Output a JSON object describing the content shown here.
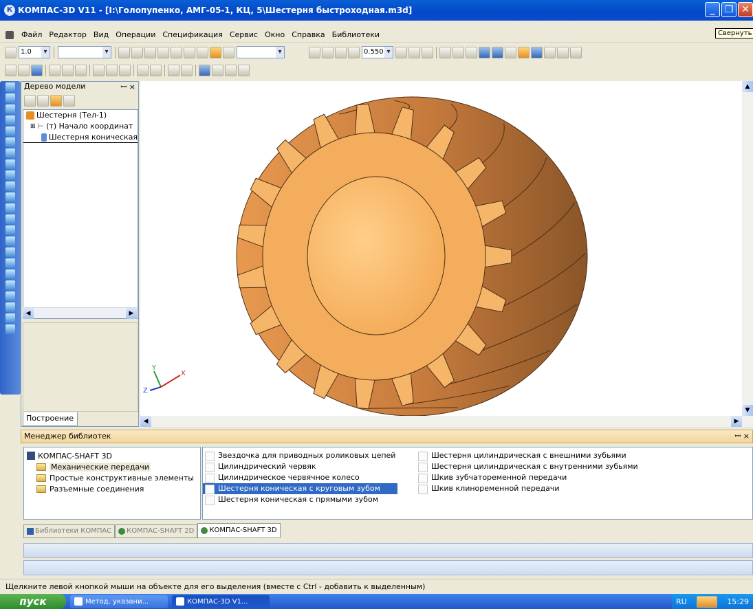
{
  "window": {
    "title": "КОМПАС-3D V11 - [I:\\Голопупенко, АМГ-05-1, КЦ, 5\\Шестерня быстроходная.m3d]",
    "minimize": "_",
    "restore": "❐",
    "close": "✕"
  },
  "menu": [
    "Файл",
    "Редактор",
    "Вид",
    "Операции",
    "Спецификация",
    "Сервис",
    "Окно",
    "Справка",
    "Библиотеки"
  ],
  "tooltip": "Свернуть",
  "toolbar": {
    "scale_value": "1.0",
    "zoom_value": "0.550"
  },
  "tree": {
    "title": "Дерево модели",
    "pin": "ꟷ ×",
    "nodes": [
      "Шестерня (Тел-1)",
      "(т) Начало координат",
      "Шестерня коническая"
    ]
  },
  "build_tab": "Построение",
  "library": {
    "title": "Менеджер библиотек",
    "pin": "ꟷ ×",
    "tree": [
      "КОМПАС-SHAFT 3D",
      "Механические передачи",
      "Простые конструктивные элементы",
      "Разъемные соединения"
    ],
    "items_col1": [
      "Звездочка для приводных роликовых цепей",
      "Цилиндрический червяк",
      "Цилиндрическое червячное колесо",
      "Шестерня коническая с круговым зубом",
      "Шестерня коническая с прямыми зубом"
    ],
    "items_col2": [
      "Шестерня цилиндрическая с внешними зубьями",
      "Шестерня цилиндрическая с внутренними зубьями",
      "Шкив зубчатоременной передачи",
      "Шкив клиноременной передачи"
    ],
    "tabs": [
      "Библиотеки КОМПАС",
      "КОМПАС-SHAFT 2D",
      "КОМПАС-SHAFT 3D"
    ]
  },
  "status": "Щелкните левой кнопкой мыши на объекте для его выделения (вместе с Ctrl - добавить к выделенным)",
  "taskbar": {
    "start": "пуск",
    "tasks": [
      "Метод. указани...",
      "КОМПАС-3D V1..."
    ],
    "lang": "RU",
    "clock": "15:29"
  },
  "axes": {
    "x": "X",
    "y": "Y",
    "z": "Z"
  }
}
